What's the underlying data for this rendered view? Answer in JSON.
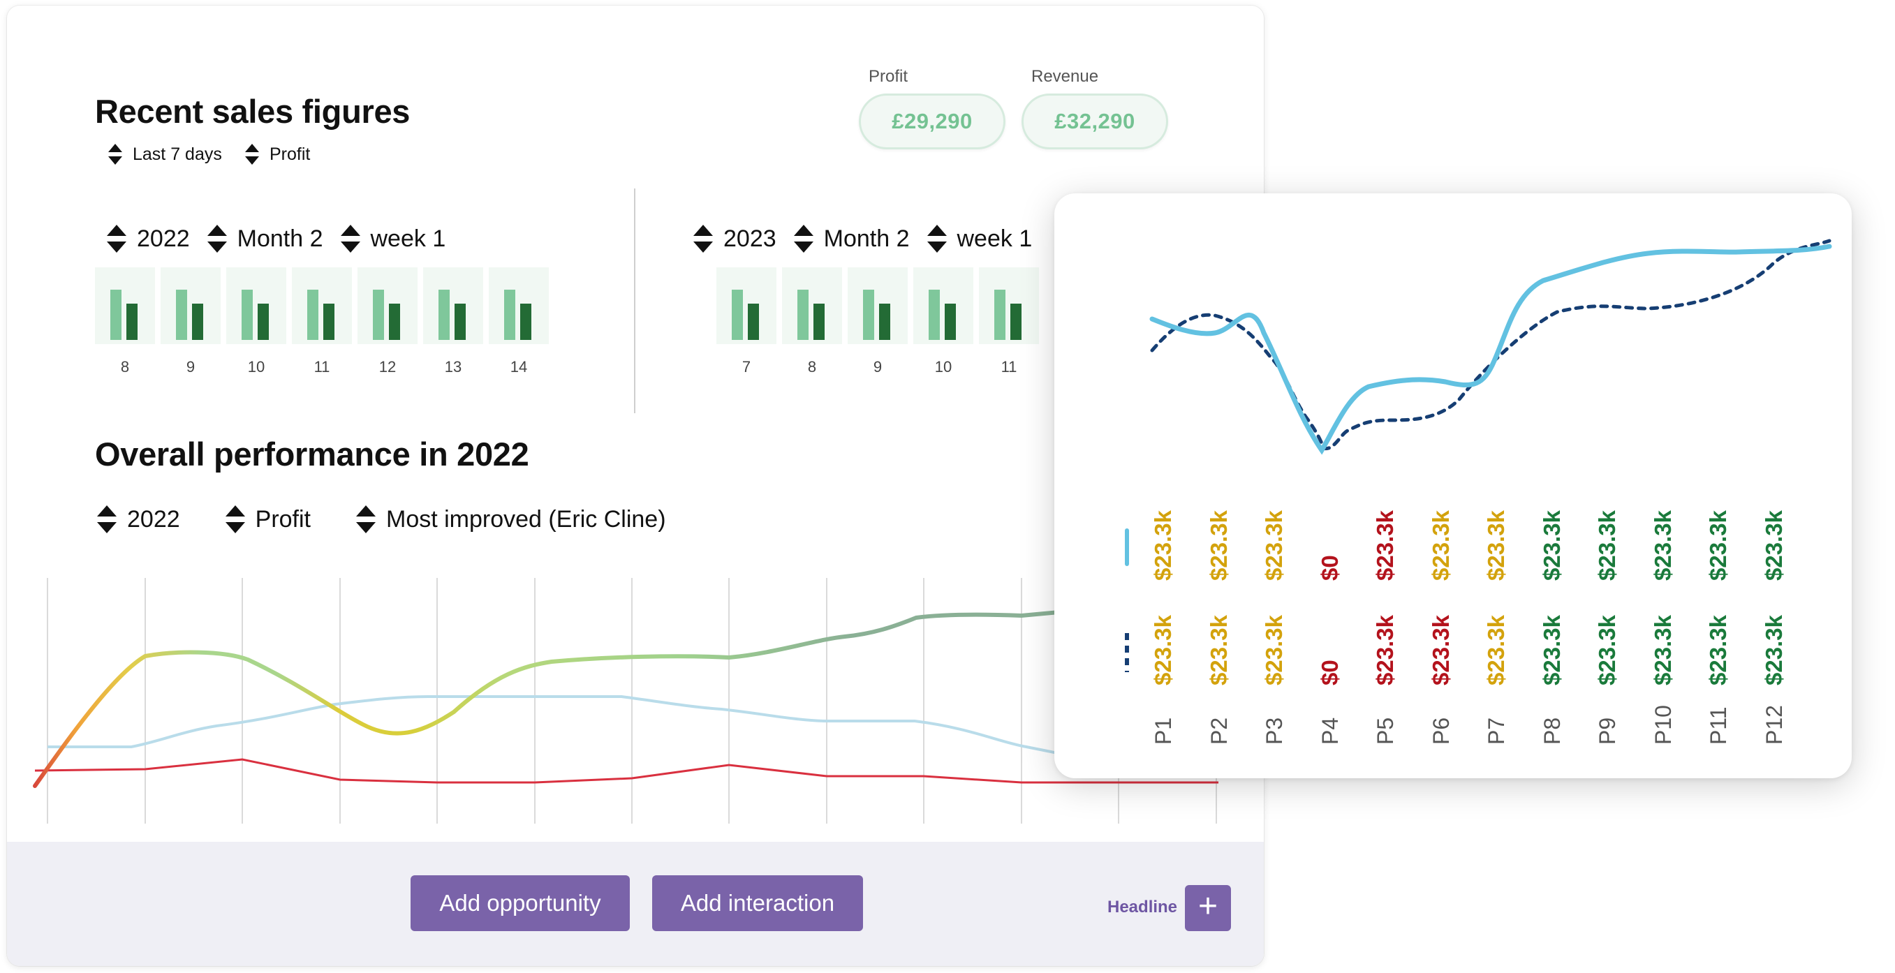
{
  "main": {
    "title": "Recent sales figures",
    "filters": [
      {
        "label": "Last 7 days"
      },
      {
        "label": "Profit"
      }
    ],
    "kpis": [
      {
        "label": "Profit",
        "value": "£29,290"
      },
      {
        "label": "Revenue",
        "value": "£32,290"
      }
    ],
    "period_a": {
      "year": "2022",
      "month": "Month 2",
      "week": "week 1",
      "days": [
        "8",
        "9",
        "10",
        "11",
        "12",
        "13",
        "14"
      ]
    },
    "period_b": {
      "year": "2023",
      "month": "Month 2",
      "week": "week 1",
      "days": [
        "7",
        "8",
        "9",
        "10",
        "11"
      ]
    },
    "performance": {
      "title": "Overall performance in 2022",
      "selectors": [
        "2022",
        "Profit",
        "Most improved (Eric Cline)"
      ]
    },
    "buttons": {
      "add_opportunity": "Add opportunity",
      "add_interaction": "Add interaction"
    },
    "headline": {
      "label": "Headline",
      "add_symbol": "+"
    }
  },
  "overlay": {
    "periods": [
      "P1",
      "P2",
      "P3",
      "P4",
      "P5",
      "P6",
      "P7",
      "P8",
      "P9",
      "P10",
      "P11",
      "P12"
    ],
    "solid_values": [
      "$23.3k",
      "$23.3k",
      "$23.3k",
      "$0",
      "$23.3k",
      "$23.3k",
      "$23.3k",
      "$23.3k",
      "$23.3k",
      "$23.3k",
      "$23.3k",
      "$23.3k"
    ],
    "solid_colors": [
      "#d3a20c",
      "#d3a20c",
      "#d3a20c",
      "#b3121c",
      "#b3121c",
      "#d3a20c",
      "#d3a20c",
      "#1a7a3b",
      "#1a7a3b",
      "#1a7a3b",
      "#1a7a3b",
      "#1a7a3b"
    ],
    "dotted_values": [
      "$23.3k",
      "$23.3k",
      "$23.3k",
      "$0",
      "$23.3k",
      "$23.3k",
      "$23.3k",
      "$23.3k",
      "$23.3k",
      "$23.3k",
      "$23.3k",
      "$23.3k"
    ],
    "dotted_colors": [
      "#d3a20c",
      "#d3a20c",
      "#d3a20c",
      "#b3121c",
      "#b3121c",
      "#b3121c",
      "#d3a20c",
      "#1a7a3b",
      "#1a7a3b",
      "#1a7a3b",
      "#1a7a3b",
      "#1a7a3b"
    ],
    "line_colors": {
      "solid": "#62c1e1",
      "dotted": "#163e73"
    }
  }
}
